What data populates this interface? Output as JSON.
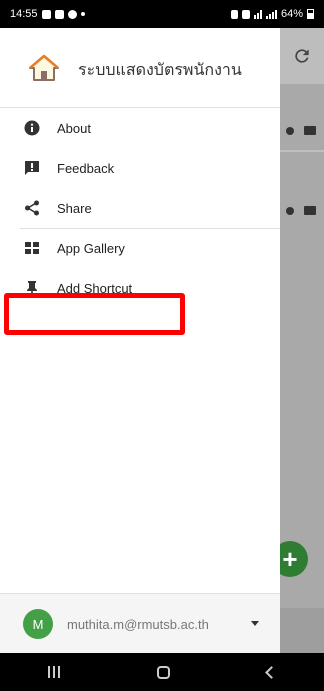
{
  "status_bar": {
    "time": "14:55",
    "battery": "64%"
  },
  "drawer": {
    "title": "ระบบแสดงบัตรพนักงาน",
    "items": [
      {
        "label": "About",
        "icon": "info-icon"
      },
      {
        "label": "Feedback",
        "icon": "feedback-icon"
      },
      {
        "label": "Share",
        "icon": "share-icon"
      },
      {
        "label": "App Gallery",
        "icon": "app-gallery-icon"
      },
      {
        "label": "Add Shortcut",
        "icon": "pin-icon"
      }
    ],
    "footer": {
      "avatar_letter": "M",
      "email": "muthita.m@rmutsb.ac.th"
    }
  },
  "colors": {
    "highlight": "#ff0000",
    "avatar": "#43a047",
    "fab": "#2e7d32"
  }
}
